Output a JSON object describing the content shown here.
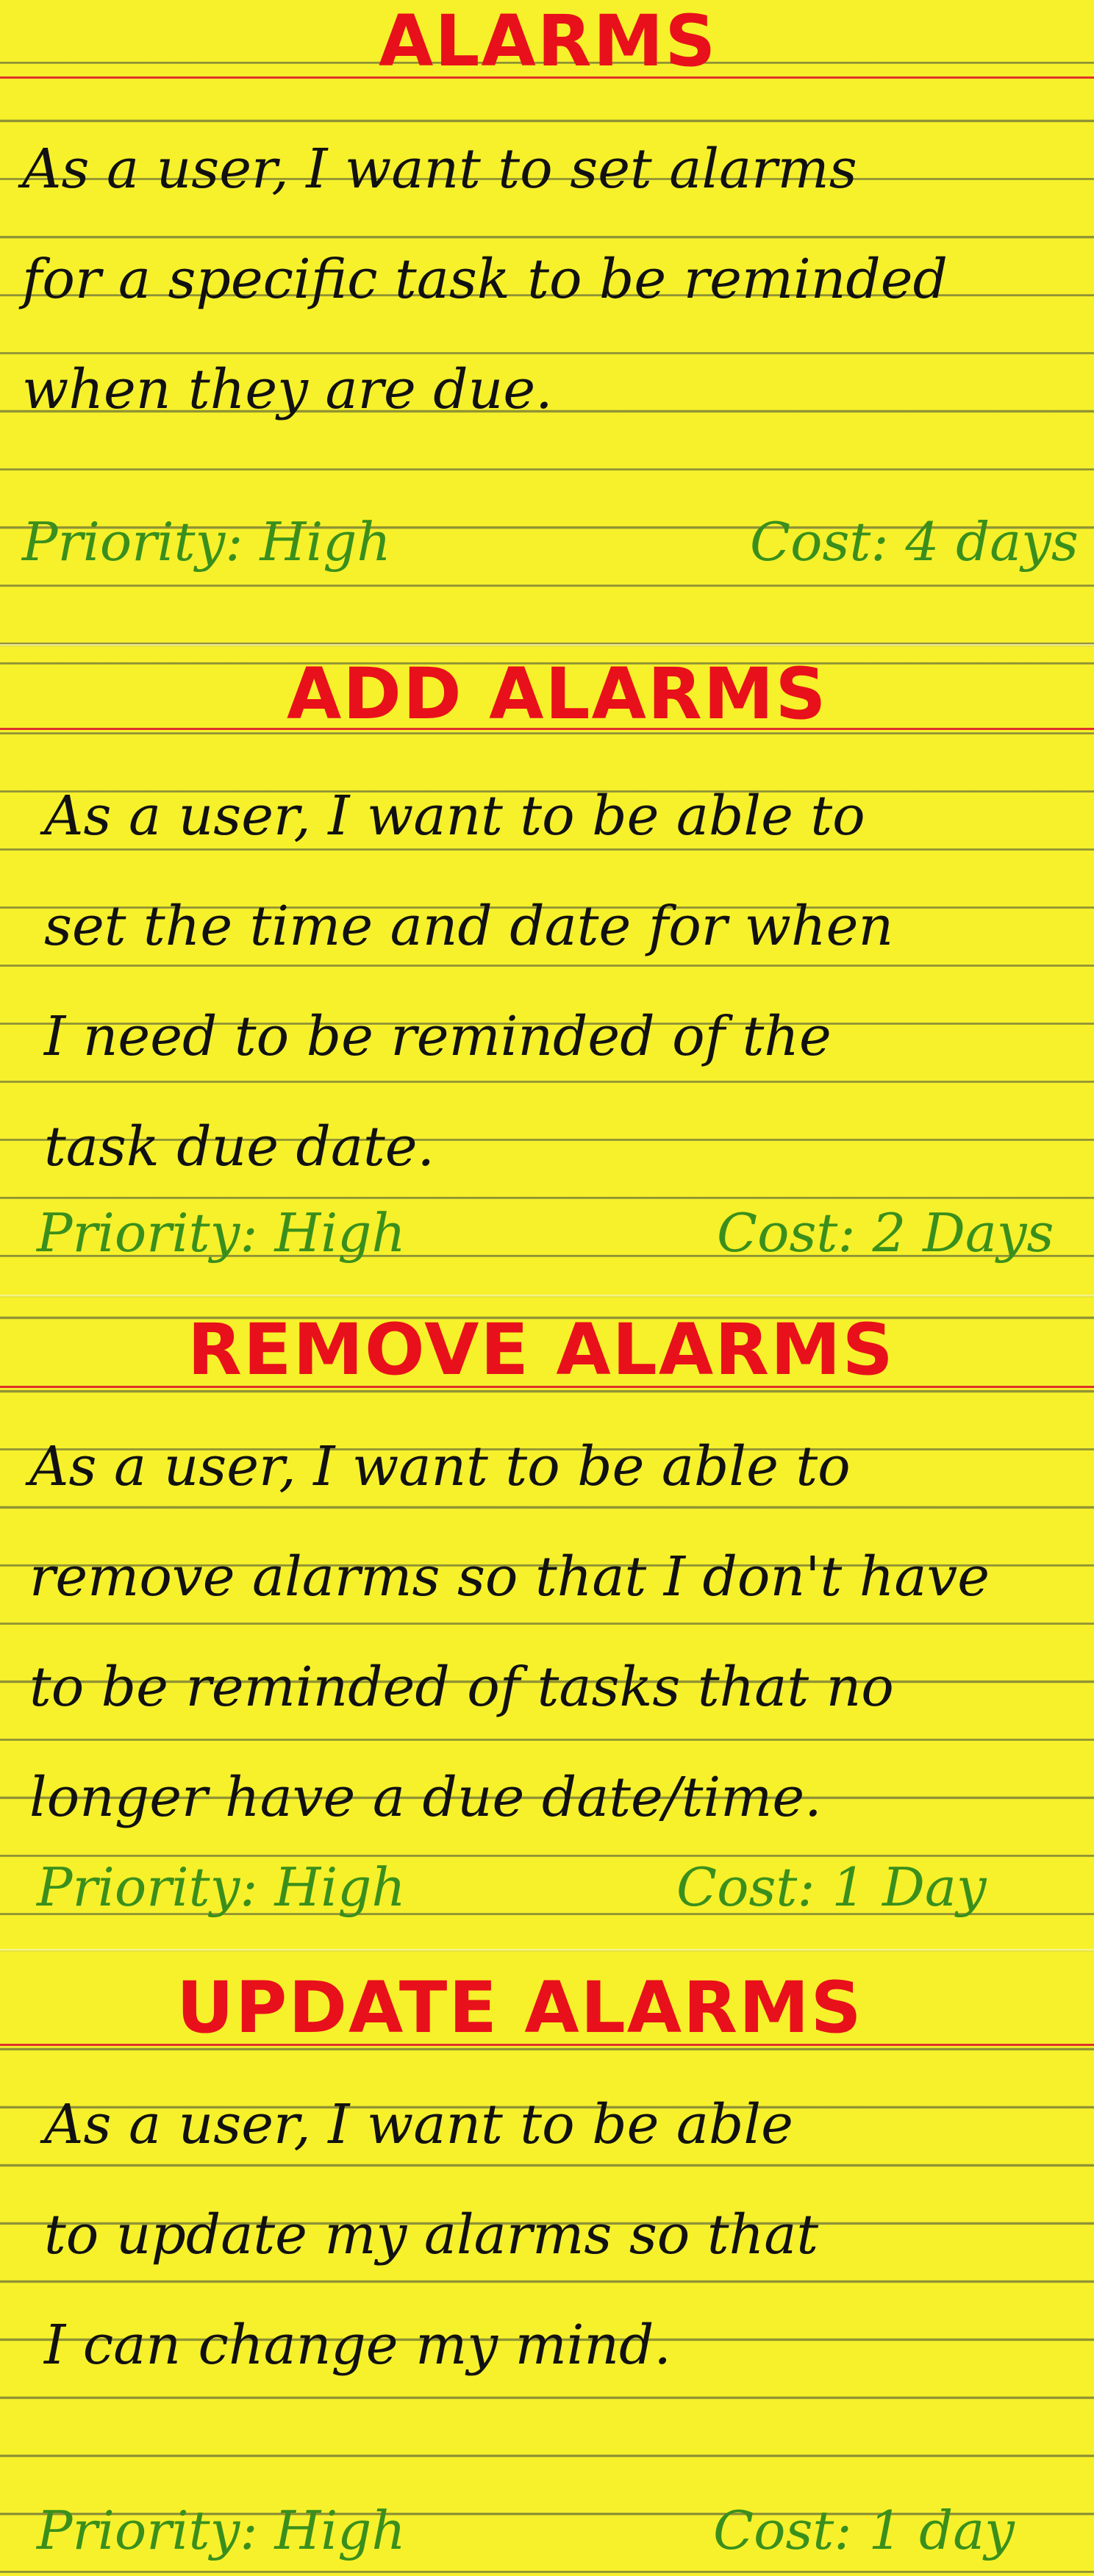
{
  "cards": [
    {
      "title": "ALARMS",
      "lines": [
        "As a user, I want to set alarms",
        "for a specific task to be reminded",
        "when they are due."
      ],
      "priority": "Priority: High",
      "cost": "Cost: 4 days"
    },
    {
      "title": "ADD ALARMS",
      "lines": [
        "As a user, I want to be able to",
        "set the time and date for when",
        "I need to be reminded of the",
        "task due date."
      ],
      "priority": "Priority: High",
      "cost": "Cost: 2 Days"
    },
    {
      "title": "REMOVE ALARMS",
      "lines": [
        "As a user, I want to be able to",
        "remove alarms so that I don't have",
        "to be reminded of tasks that no",
        "longer have a due date/time."
      ],
      "priority": "Priority: High",
      "cost": "Cost: 1 Day"
    },
    {
      "title": "UPDATE ALARMS",
      "lines": [
        "As a user, I want to be able",
        "to update my alarms so that",
        "I can change my mind."
      ],
      "priority": "Priority: High",
      "cost": "Cost: 1 day"
    }
  ],
  "colors": {
    "paper": "#f6f12b",
    "title": "#e8101a",
    "ink": "#111111",
    "meta": "#3a8f1c",
    "rule": "#e0312c"
  }
}
